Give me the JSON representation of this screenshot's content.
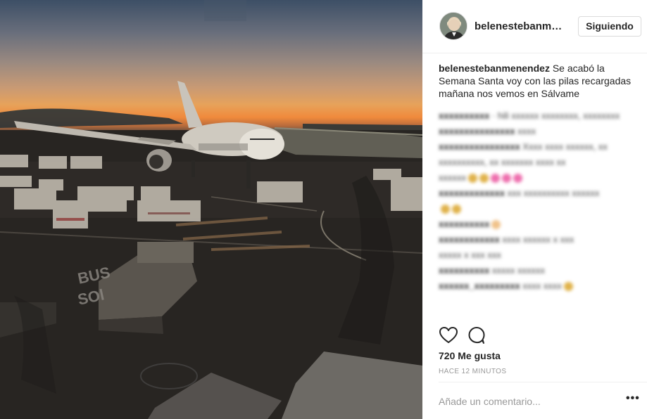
{
  "post": {
    "username_short": "belenestebanme...",
    "follow_label": "Siguiendo",
    "caption_user": "belenestebanmenendez",
    "caption_text": " Se acabó la Semana Santa voy con las pilas recargadas mañana nos vemos en Sálvame",
    "likes": "720 Me gusta",
    "time": "HACE 12 MINUTOS",
    "add_comment_placeholder": "Añade un comentario...",
    "more_label": "•••",
    "photo_text": "BUS SOL"
  },
  "blurred_comments": [
    {
      "user": "xxxxxxxxxx",
      "text": " · hili xxxxxx xxxxxxxx, xxxxxxxx"
    },
    {
      "user": "",
      "text": "@xxxxxxxxxxxxxxx"
    },
    {
      "user": "xxxxxxxxxxxxxxx",
      "text": " xxxx"
    },
    {
      "user": "xxxxxxxxxxxxxxxx",
      "text": " Xxxx xxxx xxxxxx, xx"
    },
    {
      "user": "",
      "text": "xxxxxxxxxx, xx xxxxxxx xxxx xx"
    },
    {
      "user": "",
      "text": "xxxxxx"
    },
    {
      "user": "xxxxxxxxxxxxx",
      "text": " xxx xxxxxxxxxx xxxxxx"
    },
    {
      "user": "",
      "text": ""
    },
    {
      "user": "xxxxxxxxxx",
      "text": ""
    },
    {
      "user": "xxxxxxxxxxxx",
      "text": " xxxx xxxxxx x xxx"
    },
    {
      "user": "",
      "text": "xxxxx x xxx xxx"
    },
    {
      "user": "xxxxxxxxxx",
      "text": " xxxxx xxxxxx"
    },
    {
      "user": "xxxxxx_xxxxxxxxx",
      "text": " xxxx xxxx"
    }
  ],
  "colors": {
    "border": "#efefef",
    "muted": "#999999",
    "text": "#262626"
  },
  "icons": {
    "like": "heart-icon",
    "comment": "comment-icon"
  }
}
